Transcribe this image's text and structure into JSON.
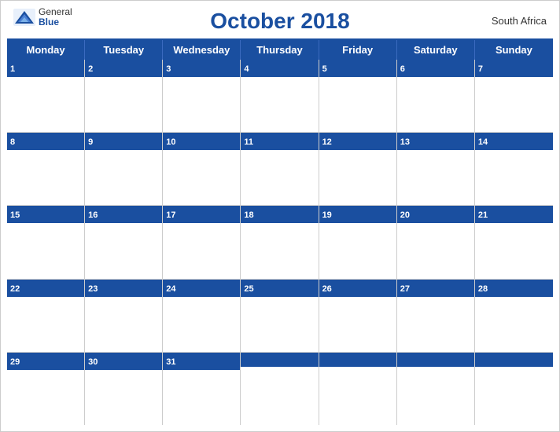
{
  "header": {
    "title": "October 2018",
    "country": "South Africa",
    "logo": {
      "general": "General",
      "blue": "Blue"
    }
  },
  "days_of_week": [
    "Monday",
    "Tuesday",
    "Wednesday",
    "Thursday",
    "Friday",
    "Saturday",
    "Sunday"
  ],
  "weeks": [
    [
      {
        "day": 1,
        "empty": false
      },
      {
        "day": 2,
        "empty": false
      },
      {
        "day": 3,
        "empty": false
      },
      {
        "day": 4,
        "empty": false
      },
      {
        "day": 5,
        "empty": false
      },
      {
        "day": 6,
        "empty": false
      },
      {
        "day": 7,
        "empty": false
      }
    ],
    [
      {
        "day": 8,
        "empty": false
      },
      {
        "day": 9,
        "empty": false
      },
      {
        "day": 10,
        "empty": false
      },
      {
        "day": 11,
        "empty": false
      },
      {
        "day": 12,
        "empty": false
      },
      {
        "day": 13,
        "empty": false
      },
      {
        "day": 14,
        "empty": false
      }
    ],
    [
      {
        "day": 15,
        "empty": false
      },
      {
        "day": 16,
        "empty": false
      },
      {
        "day": 17,
        "empty": false
      },
      {
        "day": 18,
        "empty": false
      },
      {
        "day": 19,
        "empty": false
      },
      {
        "day": 20,
        "empty": false
      },
      {
        "day": 21,
        "empty": false
      }
    ],
    [
      {
        "day": 22,
        "empty": false
      },
      {
        "day": 23,
        "empty": false
      },
      {
        "day": 24,
        "empty": false
      },
      {
        "day": 25,
        "empty": false
      },
      {
        "day": 26,
        "empty": false
      },
      {
        "day": 27,
        "empty": false
      },
      {
        "day": 28,
        "empty": false
      }
    ],
    [
      {
        "day": 29,
        "empty": false
      },
      {
        "day": 30,
        "empty": false
      },
      {
        "day": 31,
        "empty": false
      },
      {
        "day": null,
        "empty": true
      },
      {
        "day": null,
        "empty": true
      },
      {
        "day": null,
        "empty": true
      },
      {
        "day": null,
        "empty": true
      }
    ]
  ],
  "colors": {
    "header_bg": "#1a4fa0",
    "header_text": "#ffffff",
    "title_color": "#1a4fa0",
    "border": "#cccccc"
  }
}
